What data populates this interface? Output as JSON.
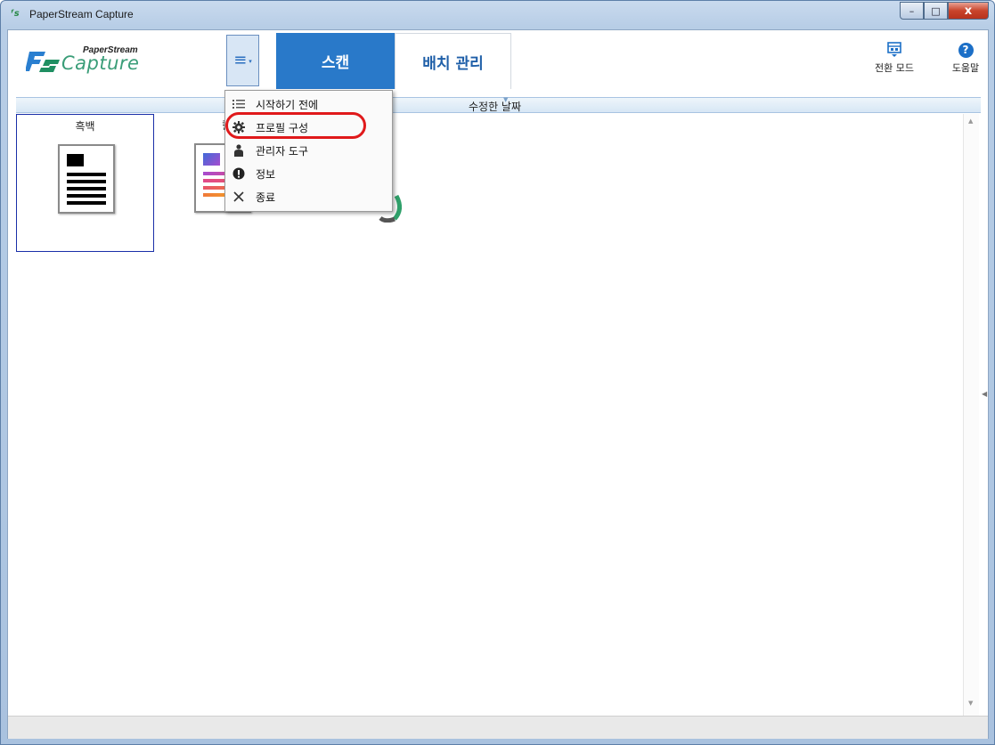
{
  "window": {
    "title": "PaperStream Capture",
    "buttons": {
      "minimize": "–",
      "maximize": "□",
      "close": "x"
    }
  },
  "logo": {
    "top": "PaperStream",
    "main": "Capture"
  },
  "menu_button": {
    "icon": "≡",
    "caret": "▾"
  },
  "tabs": [
    {
      "label": "스캔",
      "active": true
    },
    {
      "label": "배치 관리",
      "active": false
    }
  ],
  "toolbar": {
    "switch_mode": {
      "label": "전환 모드",
      "icon": "switch-mode-icon"
    },
    "help": {
      "label": "도움말",
      "icon": "help-icon",
      "glyph": "?"
    }
  },
  "sortbar": {
    "label": "수정한 날짜",
    "arrow": "▼"
  },
  "profiles": [
    {
      "name": "흑백",
      "selected": true,
      "type": "bw"
    },
    {
      "name": "칼",
      "selected": false,
      "type": "color"
    }
  ],
  "dropdown": {
    "items": [
      {
        "label": "시작하기 전에",
        "icon": "list-icon",
        "glyph": "☰"
      },
      {
        "label": "프로필 구성",
        "icon": "gear-icon",
        "glyph": "⚙",
        "highlighted": true
      },
      {
        "label": "관리자 도구",
        "icon": "user-icon",
        "glyph": "👤"
      },
      {
        "label": "정보",
        "icon": "info-icon",
        "glyph": "!"
      },
      {
        "label": "종료",
        "icon": "close-icon",
        "glyph": "✕"
      }
    ]
  },
  "colors": {
    "accent": "#2979c9",
    "highlight_ring": "#e0191b",
    "logo_green": "#3a9d78"
  }
}
